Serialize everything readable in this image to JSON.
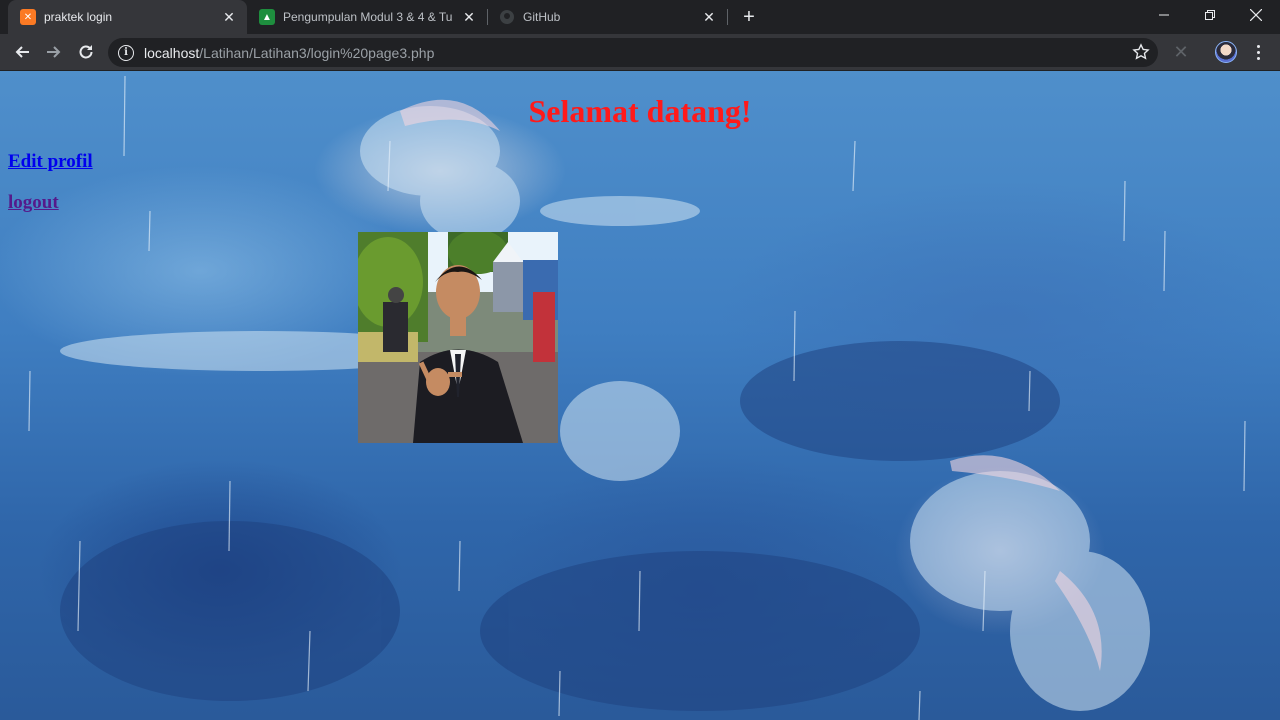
{
  "browser": {
    "tabs": [
      {
        "title": "praktek login",
        "active": true,
        "favicon": "xampp-icon"
      },
      {
        "title": "Pengumpulan Modul 3 & 4 & Tu",
        "active": false,
        "favicon": "classroom-icon"
      },
      {
        "title": "GitHub",
        "active": false,
        "favicon": "github-icon"
      }
    ],
    "url_host": "localhost",
    "url_path": "/Latihan/Latihan3/login%20page3.php"
  },
  "page": {
    "heading": "Selamat datang!",
    "links": {
      "edit_profile": "Edit profil",
      "logout": "logout"
    },
    "colors": {
      "heading": "#ff1a1a",
      "link": "#0000ee",
      "visited_link": "#551a8b"
    }
  }
}
